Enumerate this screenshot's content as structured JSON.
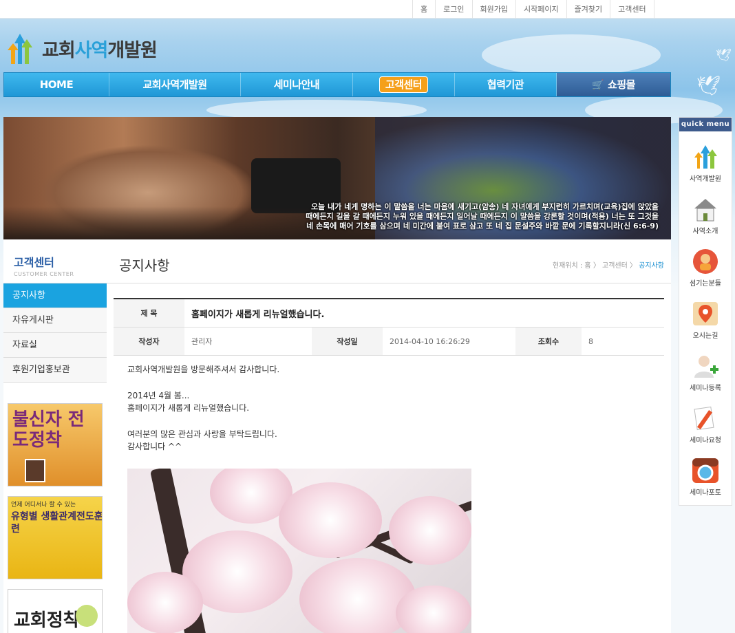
{
  "top_links": [
    "홈",
    "로그인",
    "회원가입",
    "시작페이지",
    "즐겨찾기",
    "고객센터"
  ],
  "logo": {
    "text_main": "교회",
    "text_accent": "사역",
    "text_tail": "개발원"
  },
  "nav": {
    "items": [
      "HOME",
      "교회사역개발원",
      "세미나안내",
      "고객센터",
      "협력기관",
      "쇼핑몰"
    ],
    "active": "고객센터"
  },
  "banner": {
    "verse_line1": "오늘 내가 네게 명하는 이 말씀을 너는 마음에 새기고(암송) 네 자녀에게 부지런히 가르치며(교육)집에 앉았을",
    "verse_line2": "때에든지 길을 갈 때에든지 누워 있을 때에든지 일어날 때에든지 이 말씀을 강론할 것이며(적용) 너는 또 그것을",
    "verse_line3": "네 손목에 매어 기호를 삼으며 네 미간에 붙여 표로 삼고 또 네 집 문설주와 바깥 문에 기록할지니라(신 6:6-9)"
  },
  "sidebar": {
    "title": "고객센터",
    "subtitle": "CUSTOMER CENTER",
    "menu": [
      "공지사항",
      "자유게시판",
      "자료실",
      "후원기업홍보관"
    ],
    "active": "공지사항",
    "ads": [
      {
        "headline": "불신자 전도정착"
      },
      {
        "topline": "언제 어디서나 할 수 있는",
        "headline": "유형별 생활관계전도훈련"
      },
      {
        "headline": "교회정착"
      }
    ]
  },
  "content": {
    "title": "공지사항",
    "breadcrumb": {
      "label": "현재위치 : ",
      "home": "홈",
      "sep": "〉",
      "section": "고객센터",
      "current": "공지사항"
    },
    "board": {
      "subject_label": "제 목",
      "subject": "홈페이지가 새롭게 리뉴얼했습니다.",
      "author_label": "작성자",
      "author": "관리자",
      "date_label": "작성일",
      "date": "2014-04-10 16:26:29",
      "views_label": "조회수",
      "views": "8"
    },
    "body": {
      "line1": "교회사역개발원을 방문해주셔서 감사합니다.",
      "line2": "2014년 4월 봄...",
      "line3": "홈페이지가 새롭게 리뉴얼했습니다.",
      "line4": "여러분의 많은 관심과 사랑을 부탁드립니다.",
      "line5": "감사합니다 ^^"
    }
  },
  "quick_menu": {
    "header": "quick menu",
    "items": [
      "사역개발원",
      "사역소개",
      "섬기는분들",
      "오시는길",
      "세미나등록",
      "세미나요청",
      "세미나포토"
    ]
  },
  "colors": {
    "accent": "#1aa3e0",
    "nav": "#2aa8e4",
    "active_badge": "#f5a01a",
    "shop": "#2e5c95"
  }
}
